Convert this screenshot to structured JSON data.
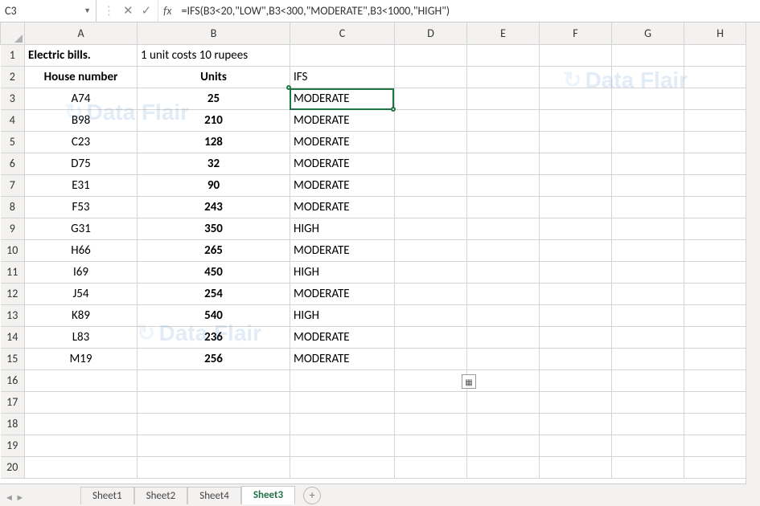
{
  "namebox": "C3",
  "formula": "=IFS(B3<20,\"LOW\",B3<300,\"MODERATE\",B3<1000,\"HIGH\")",
  "columns": [
    "A",
    "B",
    "C",
    "D",
    "E",
    "F",
    "G",
    "H"
  ],
  "row_headers": [
    "1",
    "2",
    "3",
    "4",
    "5",
    "6",
    "7",
    "8",
    "9",
    "10",
    "11",
    "12",
    "13",
    "14",
    "15",
    "16",
    "17",
    "18",
    "19",
    "20"
  ],
  "cells": {
    "r1": {
      "A": "Electric bills.",
      "B": "1 unit costs 10 rupees"
    },
    "r2": {
      "A": "House number",
      "B": "Units",
      "C": "IFS"
    },
    "r3": {
      "A": "A74",
      "B": "25",
      "C": "MODERATE"
    },
    "r4": {
      "A": "B98",
      "B": "210",
      "C": "MODERATE"
    },
    "r5": {
      "A": "C23",
      "B": "128",
      "C": "MODERATE"
    },
    "r6": {
      "A": "D75",
      "B": "32",
      "C": "MODERATE"
    },
    "r7": {
      "A": "E31",
      "B": "90",
      "C": "MODERATE"
    },
    "r8": {
      "A": "F53",
      "B": "243",
      "C": "MODERATE"
    },
    "r9": {
      "A": "G31",
      "B": "350",
      "C": "HIGH"
    },
    "r10": {
      "A": "H66",
      "B": "265",
      "C": "MODERATE"
    },
    "r11": {
      "A": "I69",
      "B": "450",
      "C": "HIGH"
    },
    "r12": {
      "A": "J54",
      "B": "254",
      "C": "MODERATE"
    },
    "r13": {
      "A": "K89",
      "B": "540",
      "C": "HIGH"
    },
    "r14": {
      "A": "L83",
      "B": "236",
      "C": "MODERATE"
    },
    "r15": {
      "A": "M19",
      "B": "256",
      "C": "MODERATE"
    }
  },
  "tabs": [
    "Sheet1",
    "Sheet2",
    "Sheet4",
    "Sheet3"
  ],
  "active_tab": "Sheet3",
  "watermark": "Data Flair"
}
